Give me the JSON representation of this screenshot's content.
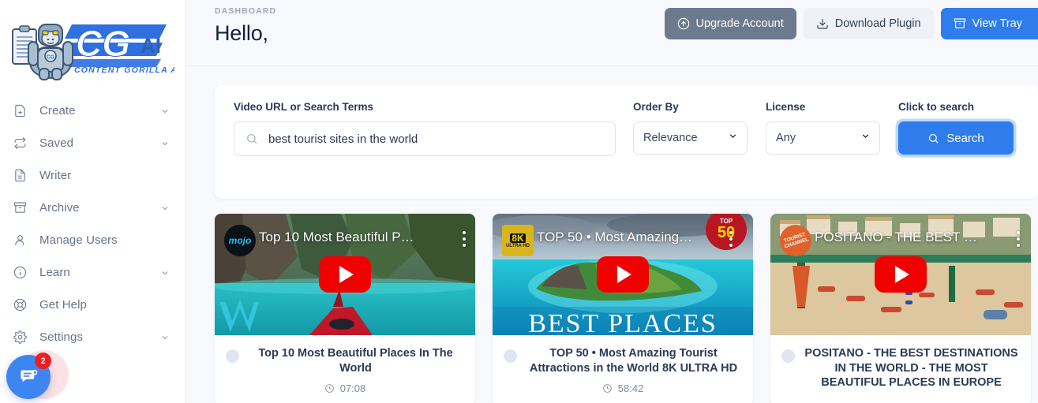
{
  "brand": {
    "logo_text_main": "CG",
    "logo_text_ai": "AI",
    "logo_tagline": "CONTENT GORILLA AI",
    "logo_badge": "CG",
    "accent_blue": "#2f7ced",
    "sidebar_text": "#64748b"
  },
  "sidebar": {
    "items": [
      {
        "label": "Create",
        "icon": "file-plus-icon",
        "chevron": true
      },
      {
        "label": "Saved",
        "icon": "refresh-icon",
        "chevron": true
      },
      {
        "label": "Writer",
        "icon": "file-text-icon",
        "chevron": false
      },
      {
        "label": "Archive",
        "icon": "archive-icon",
        "chevron": true
      },
      {
        "label": "Manage Users",
        "icon": "user-icon",
        "chevron": false
      },
      {
        "label": "Learn",
        "icon": "info-circle-icon",
        "chevron": true
      },
      {
        "label": "Get Help",
        "icon": "lifebuoy-icon",
        "chevron": false
      },
      {
        "label": "Settings",
        "icon": "gear-icon",
        "chevron": true
      }
    ],
    "chat": {
      "badge_count": "2",
      "icon": "chat-bubble-icon"
    }
  },
  "header": {
    "breadcrumb": "DASHBOARD",
    "greeting": "Hello,",
    "actions": {
      "upgrade_label": "Upgrade Account",
      "upgrade_icon": "arrow-up-circle-icon",
      "download_label": "Download Plugin",
      "download_icon": "download-icon",
      "tray_label": "View Tray",
      "tray_icon": "archive-icon"
    }
  },
  "search_panel": {
    "query_label": "Video URL or Search Terms",
    "query_value": "best tourist sites in the world",
    "query_placeholder": "Video URL or Search Terms",
    "query_icon": "search-icon",
    "order_label": "Order By",
    "order_value": "Relevance",
    "order_options": [
      "Relevance"
    ],
    "license_label": "License",
    "license_value": "Any",
    "license_options": [
      "Any"
    ],
    "search_hint_label": "Click to search",
    "search_button_label": "Search",
    "search_button_icon": "search-icon"
  },
  "results": {
    "cards": [
      {
        "overlay_title": "Top 10 Most Beautiful P…",
        "title": "Top 10 Most Beautiful Places In The World",
        "duration": "07:08",
        "channel_logo_text": "mojo",
        "watermark": "WM",
        "play_icon": "youtube-play-icon",
        "menu_icon": "kebab-menu-icon",
        "clock_icon": "clock-icon"
      },
      {
        "overlay_title": "TOP 50 • Most Amazing…",
        "title": "TOP 50 • Most Amazing Tourist Attractions in the World 8K ULTRA HD",
        "duration": "58:42",
        "channel_logo_text": "8K",
        "channel_logo_sub": "ULTRA HD",
        "badge_text": "TOP 50",
        "watermark": "BEST PLACES",
        "play_icon": "youtube-play-icon",
        "menu_icon": "kebab-menu-icon",
        "clock_icon": "clock-icon"
      },
      {
        "overlay_title": "POSITANO - THE BEST …",
        "title": "POSITANO - THE BEST DESTINATIONS IN THE WORLD - THE MOST BEAUTIFUL PLACES IN EUROPE",
        "duration": "",
        "channel_logo_text": "TOURIST CHANNEL",
        "play_icon": "youtube-play-icon",
        "menu_icon": "kebab-menu-icon",
        "clock_icon": "clock-icon"
      }
    ]
  }
}
